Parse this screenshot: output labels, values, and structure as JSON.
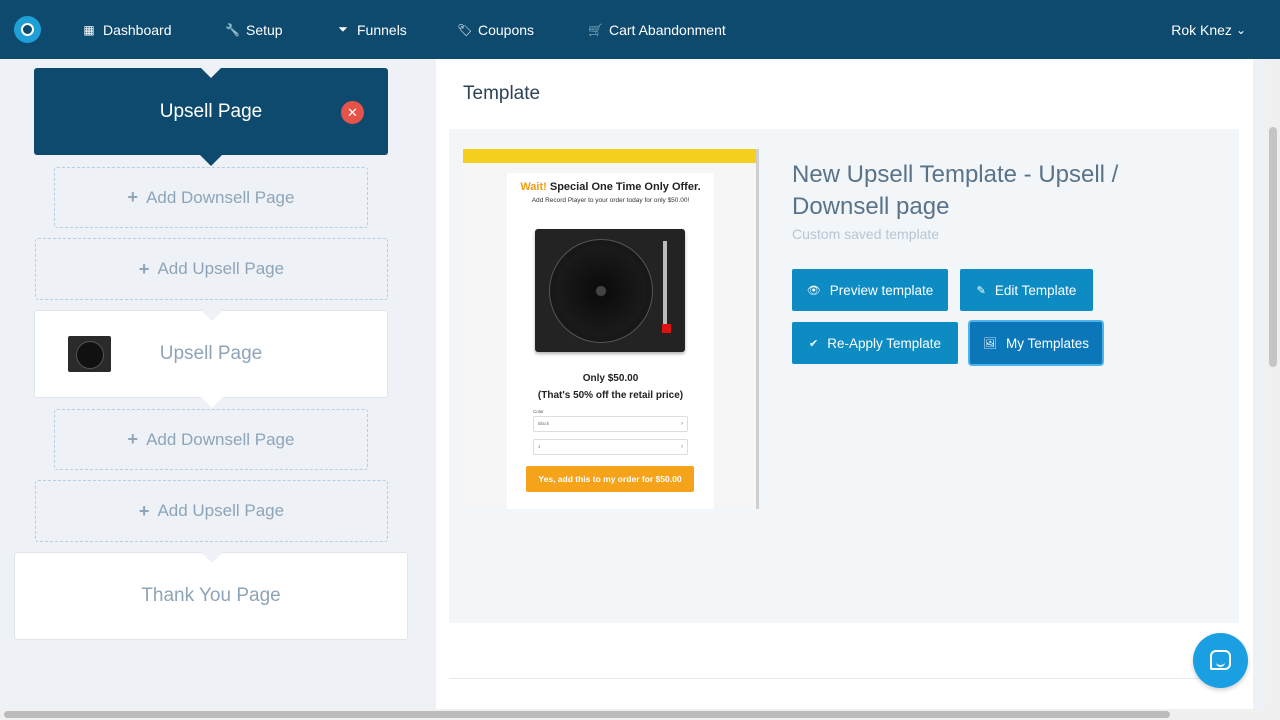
{
  "nav": {
    "items": [
      {
        "label": "Dashboard",
        "icon": "grid-icon"
      },
      {
        "label": "Setup",
        "icon": "wrench-icon"
      },
      {
        "label": "Funnels",
        "icon": "filter-icon"
      },
      {
        "label": "Coupons",
        "icon": "tag-icon"
      },
      {
        "label": "Cart Abandonment",
        "icon": "cart-icon"
      }
    ],
    "user": "Rok Knez",
    "icons": {
      "dashboard": "▦",
      "setup": "🔧",
      "funnels": "⏷",
      "coupons": "🏷",
      "cart": "🛒",
      "caret": "⌄"
    }
  },
  "funnel": {
    "active_page": "Upsell Page",
    "add_downsell": "Add Downsell Page",
    "add_upsell": "Add Upsell Page",
    "upsell_page": "Upsell Page",
    "thank_you": "Thank You Page",
    "plus": "+",
    "close": "✕"
  },
  "panel": {
    "title": "Template",
    "template_name": "New Upsell Template - Upsell / Downsell page",
    "template_desc": "Custom saved template",
    "buttons": {
      "preview": "Preview template",
      "edit": "Edit Template",
      "reapply": "Re-Apply Template",
      "my_templates": "My Templates"
    },
    "button_icons": {
      "preview": "👁",
      "edit": "✎",
      "reapply": "✔",
      "my_templates": "🖼"
    }
  },
  "preview": {
    "wait": "Wait!",
    "headline": "Special One Time Only Offer.",
    "sub": "Add Record Player to your order today for only $50.00!",
    "price": "Only $50.00",
    "discount": "(That's 50% off the retail price)",
    "color_label": "Color",
    "color_value": "Black",
    "qty_value": "1",
    "cta": "Yes, add this to my order for $50.00"
  },
  "colors": {
    "nav_bg": "#0d4a6e",
    "accent_button": "#0d8cc4",
    "close_red": "#e5534b",
    "cta_orange": "#f5a31a"
  }
}
